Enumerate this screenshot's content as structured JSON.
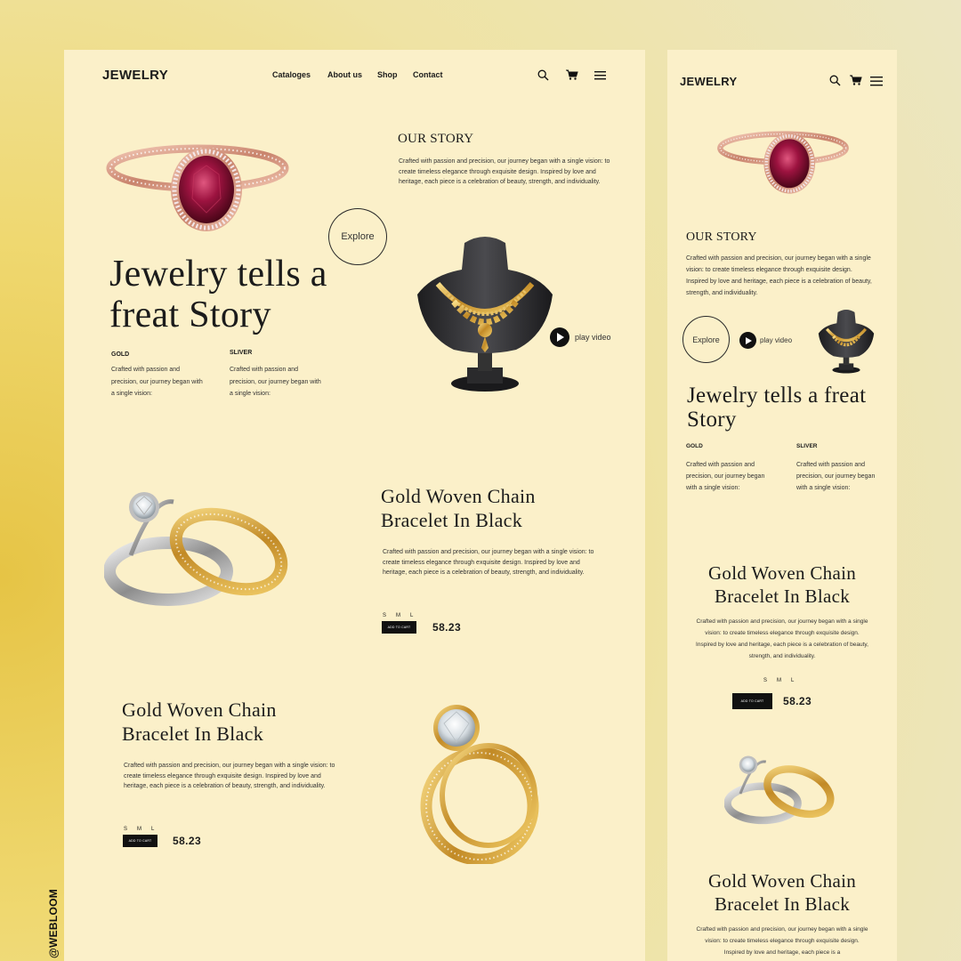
{
  "brand": "JEWELRY",
  "nav": [
    "Cataloges",
    "About us",
    "Shop",
    "Contact"
  ],
  "hero": {
    "title_line1": "Jewelry tells a",
    "title_line2": "freat Story",
    "mobile_title_line1": "Jewelry tells a freat",
    "mobile_title_line2": "Story"
  },
  "story": {
    "title": "OUR STORY",
    "text": "Crafted with passion and precision, our journey began with a single vision: to create timeless elegance through exquisite design. Inspired by love and heritage, each piece is a celebration of beauty, strength, and individuality."
  },
  "explore_label": "Explore",
  "play_label": "play video",
  "features": [
    {
      "label": "GOLD",
      "text": "Crafted with passion and precision, our journey began with a single vision:"
    },
    {
      "label": "SLIVER",
      "text": "Crafted with passion and precision, our journey began with a single vision:"
    }
  ],
  "products": [
    {
      "title_line1": "Gold Woven Chain",
      "title_line2": "Bracelet In Black",
      "text": "Crafted with passion and precision, our journey began with a single vision: to create timeless elegance through exquisite design. Inspired by love and heritage, each piece is a celebration of beauty, strength, and individuality.",
      "sizes": [
        "S",
        "M",
        "L"
      ],
      "button": "ADD TO CART",
      "price": "58.23"
    },
    {
      "title_line1": "Gold Woven Chain",
      "title_line2": "Bracelet In Black",
      "text": "Crafted with passion and precision, our journey began with a single vision: to create timeless elegance through exquisite design. Inspired by love and heritage, each piece is a celebration of beauty, strength, and individuality.",
      "sizes": [
        "S",
        "M",
        "L"
      ],
      "button": "ADD TO CART",
      "price": "58.23"
    }
  ],
  "mobile_partial_text": "Crafted with passion and precision, our journey began with a single vision: to create timeless elegance through exquisite design. Inspired by love and heritage, each piece is a",
  "watermark": "@WEBLOOM",
  "icons": [
    "search-icon",
    "cart-icon",
    "menu-icon",
    "play-icon"
  ],
  "colors": {
    "panel": "#fbf0c9",
    "ink": "#111111",
    "ruby": "#8e1136",
    "rose_gold": "#d9a08a",
    "gold": "#c99a3c"
  }
}
